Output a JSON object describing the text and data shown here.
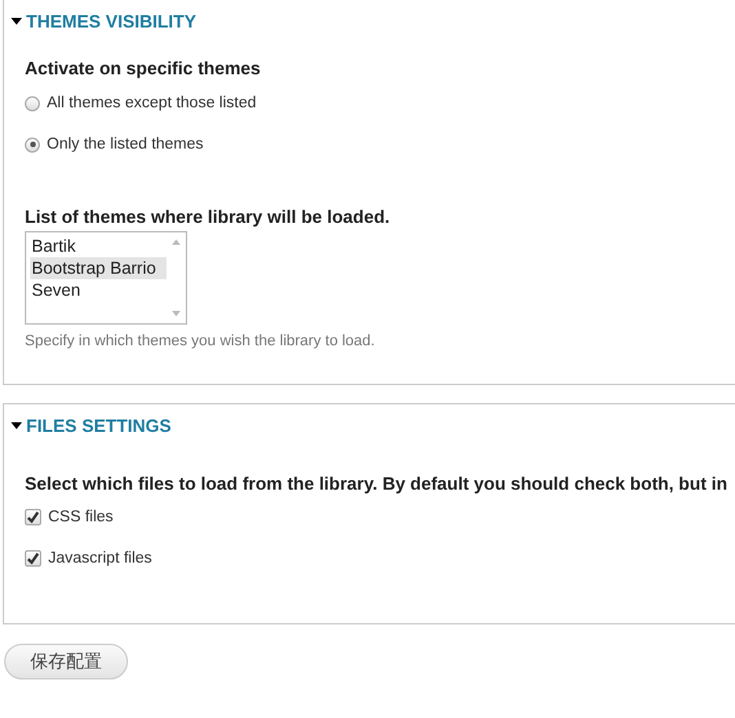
{
  "sections": [
    {
      "title": "THEMES VISIBILITY",
      "expanded": true,
      "groups": [
        {
          "kind": "radios",
          "label": "Activate on specific themes",
          "options": [
            {
              "label": "All themes except those listed",
              "selected": false
            },
            {
              "label": "Only the listed themes",
              "selected": true
            }
          ]
        },
        {
          "kind": "listbox",
          "label": "List of themes where library will be loaded.",
          "items": [
            {
              "label": "Bartik",
              "selected": false
            },
            {
              "label": "Bootstrap Barrio",
              "selected": true
            },
            {
              "label": "Seven",
              "selected": false
            }
          ],
          "description": "Specify in which themes you wish the library to load."
        }
      ]
    },
    {
      "title": "FILES SETTINGS",
      "expanded": true,
      "groups": [
        {
          "kind": "checkboxes",
          "label": "Select which files to load from the library. By default you should check both, but in",
          "options": [
            {
              "label": "CSS files",
              "checked": true
            },
            {
              "label": "Javascript files",
              "checked": true
            }
          ]
        }
      ]
    }
  ],
  "save_button": "保存配置"
}
